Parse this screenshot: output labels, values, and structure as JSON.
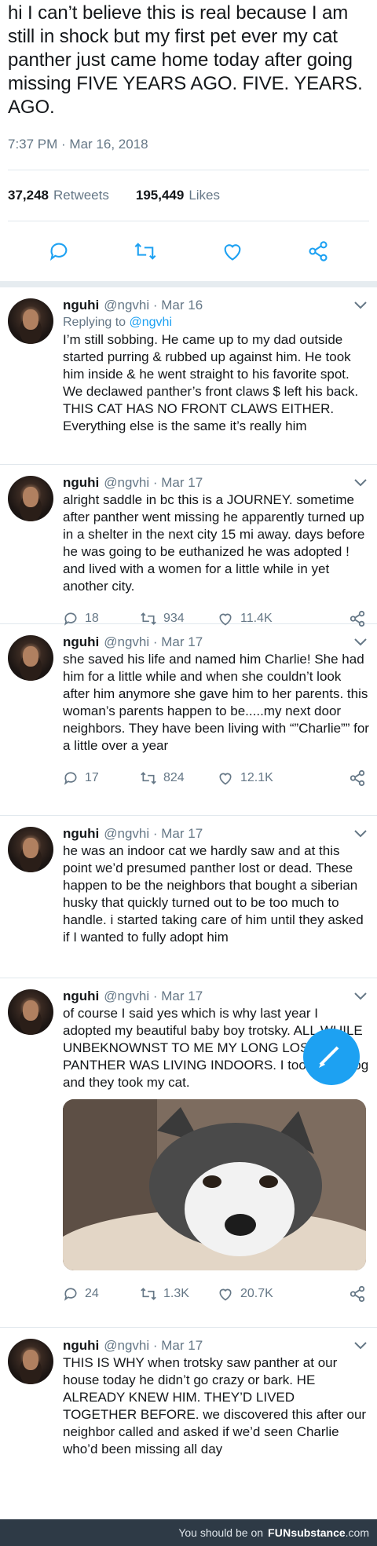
{
  "main_tweet": {
    "text": "hi I can’t believe this is real because I am still in shock but my first pet ever my cat panther just came home today after going missing FIVE YEARS AGO. FIVE. YEARS. AGO.",
    "timestamp": "7:37 PM · Mar 16, 2018",
    "retweets_count": "37,248",
    "retweets_label": "Retweets",
    "likes_count": "195,449",
    "likes_label": "Likes"
  },
  "replies": [
    {
      "name": "nguhi",
      "handle": "@ngvhi · Mar 16",
      "replying_prefix": "Replying to",
      "replying_to": "@ngvhi",
      "text": "I’m still sobbing. He came up to my dad outside started purring & rubbed up against him. He took him inside & he went straight to his favorite spot. We declawed panther’s front claws $ left his back. THIS CAT HAS NO FRONT CLAWS EITHER. Everything else is the same it’s really him"
    },
    {
      "name": "nguhi",
      "handle": "@ngvhi · Mar 17",
      "text": "alright saddle in bc this is a JOURNEY. sometime after panther went missing he apparently turned up in a shelter in the next city 15 mi away. days before he was going to be euthanized he was adopted ! and lived with a women for a little while in yet another city.",
      "replies": "18",
      "retweets": "934",
      "likes": "11.4K"
    },
    {
      "name": "nguhi",
      "handle": "@ngvhi · Mar 17",
      "text": "she saved his life and named him Charlie! She had him for a little while and when she couldn’t look after him anymore she gave him to her parents. this woman’s parents happen to be.....my next door neighbors. They have been living with “”Charlie”” for a little over a year",
      "replies": "17",
      "retweets": "824",
      "likes": "12.1K"
    },
    {
      "name": "nguhi",
      "handle": "@ngvhi · Mar 17",
      "text": "he was an indoor cat we hardly saw and at this point we’d presumed panther lost or dead. These happen to be the neighbors that bought a siberian husky that quickly turned out to be too much to handle. i started taking care of him until they asked if I wanted to fully adopt him"
    },
    {
      "name": "nguhi",
      "handle": "@ngvhi · Mar 17",
      "text": "of course I said yes which is why last year I adopted my beautiful baby boy trotsky. ALL WHILE UNBEKNOWNST TO ME MY LONG LOST CAT PANTHER WAS LIVING INDOORS. I took their dog and they took my cat.",
      "replies": "24",
      "retweets": "1.3K",
      "likes": "20.7K"
    },
    {
      "name": "nguhi",
      "handle": "@ngvhi · Mar 17",
      "text": "THIS IS WHY when trotsky saw panther at our house today he didn’t go crazy or bark. HE ALREADY KNEW HIM. THEY’D LIVED TOGETHER BEFORE. we discovered this after our neighbor called and asked if we’d seen Charlie who’d been missing all day"
    }
  ],
  "footer": {
    "prefix": "You should be on",
    "brand_a": "FUN",
    "brand_b": "substance",
    "brand_c": ".com"
  },
  "icons": {
    "accent": "#1da1f2",
    "muted": "#657786"
  }
}
